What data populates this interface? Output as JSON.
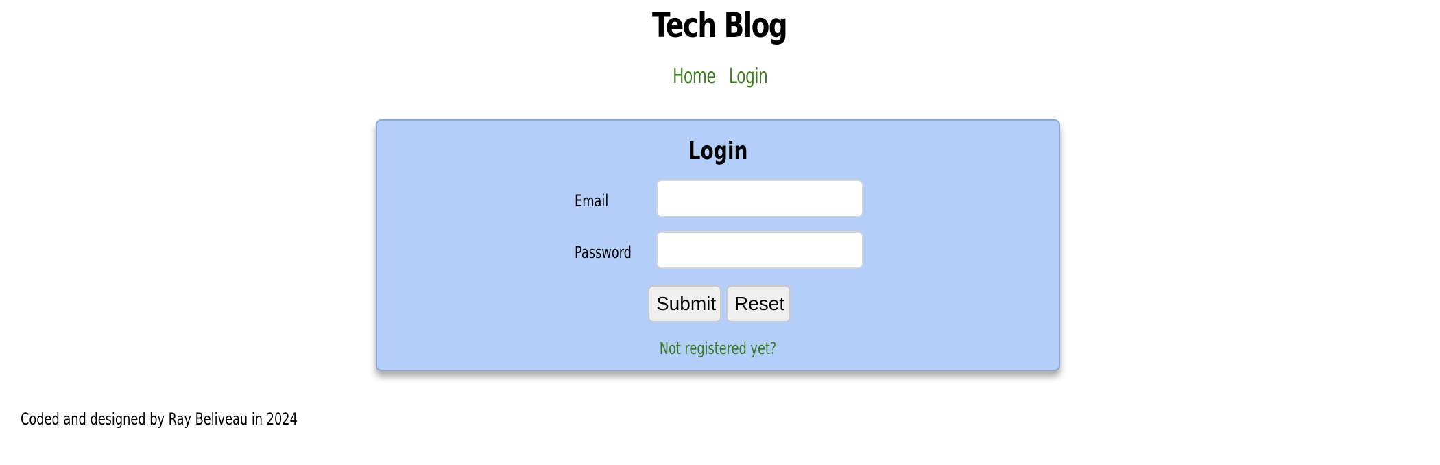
{
  "header": {
    "title": "Tech Blog"
  },
  "nav": {
    "items": [
      {
        "label": "Home"
      },
      {
        "label": "Login"
      }
    ]
  },
  "login_form": {
    "title": "Login",
    "email_label": "Email",
    "email_value": "",
    "password_label": "Password",
    "password_value": "",
    "submit_label": "Submit",
    "reset_label": "Reset",
    "register_link": "Not registered yet?"
  },
  "footer": {
    "credit": "Coded and designed by Ray Beliveau in 2024"
  },
  "colors": {
    "link_green": "#3a7d1e",
    "card_background": "#b3cef8",
    "card_border": "#8fa8d8",
    "button_background": "#efefef"
  }
}
